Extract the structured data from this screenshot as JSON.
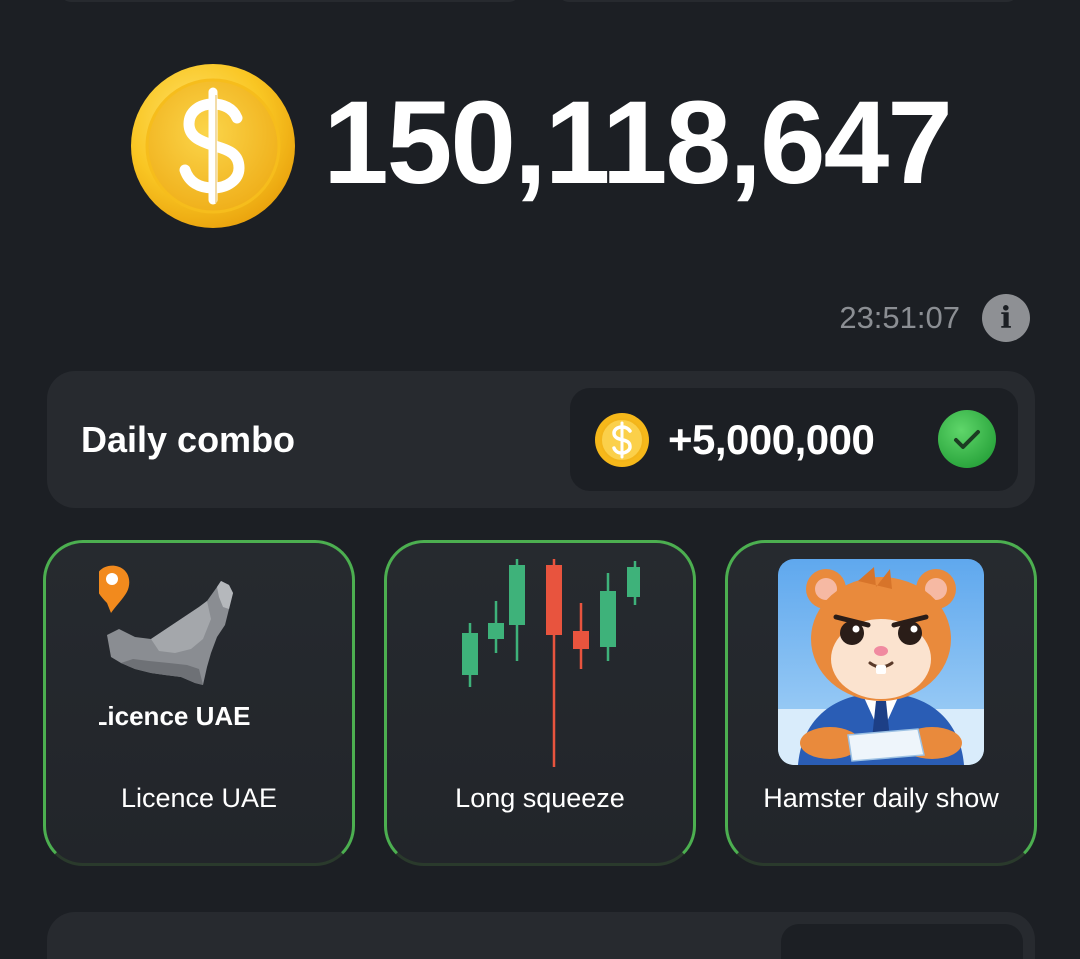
{
  "balance": {
    "value": "150,118,647"
  },
  "timer": {
    "text": "23:51:07"
  },
  "daily_combo": {
    "title": "Daily combo",
    "reward": "+5,000,000",
    "completed": true
  },
  "cards": [
    {
      "label": "Licence UAE",
      "image_caption": "Licence UAE"
    },
    {
      "label": "Long squeeze"
    },
    {
      "label": "Hamster daily show"
    }
  ],
  "colors": {
    "background": "#1c1f24",
    "card": "#272a2f",
    "accent_green": "#4caf50",
    "coin": "#f7c325",
    "candle_green": "#3eb27a",
    "candle_red": "#e8543e",
    "muted_text": "#8b8e93"
  },
  "icons": {
    "coin": "dollar-coin-icon",
    "info": "info-icon",
    "check": "check-circle-icon",
    "location": "location-pin-icon"
  }
}
